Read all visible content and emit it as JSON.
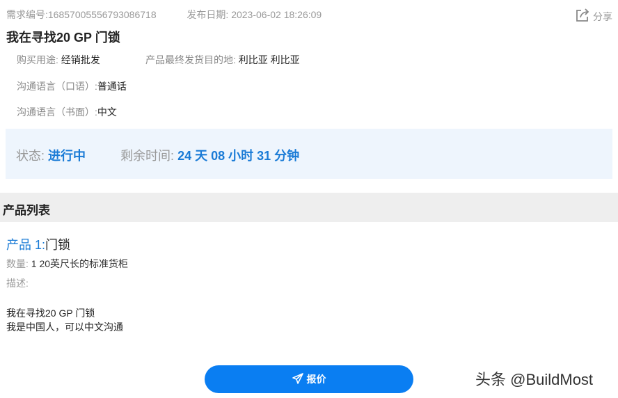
{
  "header": {
    "req_label": "需求编号:",
    "req_id": "16857005556793086718",
    "date_label": "发布日期:",
    "date": "2023-06-02 18:26:09",
    "share": "分享",
    "title": "我在寻找20 GP 门锁"
  },
  "attributes": {
    "purpose_label": "购买用途:",
    "purpose": "经销批发",
    "dest_label": "产品最终发货目的地:",
    "dest": "利比亚 利比亚",
    "spoken_label": "沟通语言（口语）:",
    "spoken": "普通话",
    "written_label": "沟通语言（书面）:",
    "written": "中文"
  },
  "status": {
    "status_label": "状态:",
    "status": "进行中",
    "remaining_label": "剩余时间:",
    "remaining": "24 天 08 小时 31 分钟"
  },
  "section": {
    "title": "产品列表"
  },
  "product": {
    "index_label": "产品 1:",
    "name": "门锁",
    "qty_label": "数量:",
    "qty": "1 20英尺长的标准货柜",
    "desc_label": "描述:",
    "desc_line1": "我在寻找20 GP 门锁",
    "desc_line2": "我是中国人，可以中文沟通"
  },
  "actions": {
    "quote": "报价"
  },
  "watermark": "头条 @BuildMost",
  "colors": {
    "accent": "#1a7bd6",
    "button": "#0a7ef2",
    "status_bg": "#eef5fd"
  }
}
